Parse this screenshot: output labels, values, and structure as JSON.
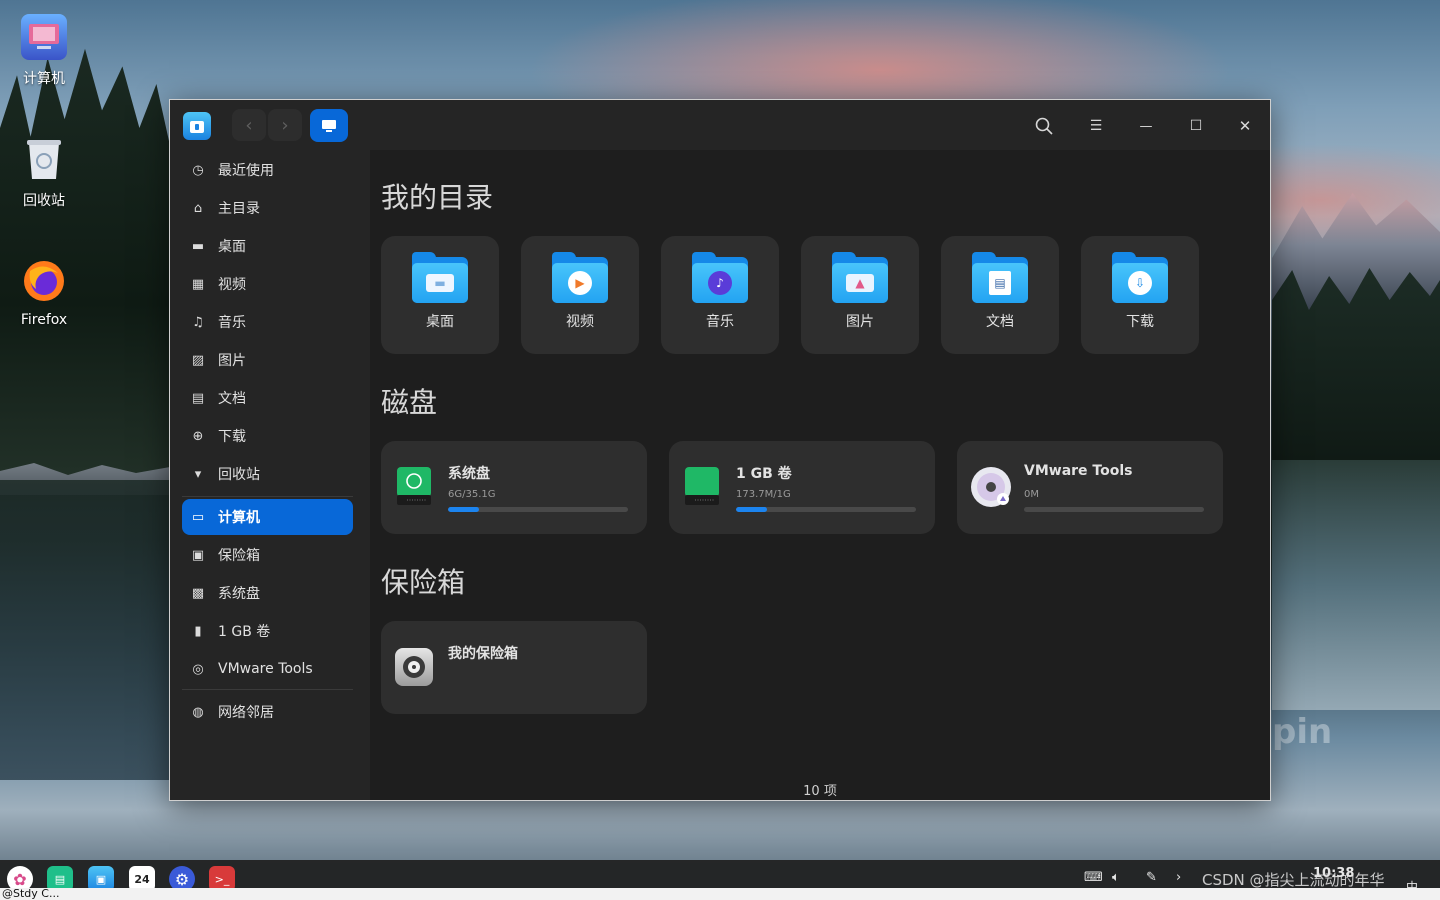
{
  "desktop": {
    "icons": [
      {
        "label": "计算机",
        "icon": "computer-icon"
      },
      {
        "label": "回收站",
        "icon": "trash-icon"
      },
      {
        "label": "Firefox",
        "icon": "firefox-icon"
      }
    ],
    "watermark": "pin"
  },
  "window": {
    "toolbar": {
      "back_icon": "‹",
      "forward_icon": "›",
      "search_icon": "search-icon",
      "menu_icon": "☰",
      "minimize_icon": "—",
      "maximize_icon": "☐",
      "close_icon": "✕"
    },
    "sidebar": {
      "items": [
        {
          "label": "最近使用",
          "icon": "clock-icon",
          "glyph": "◷"
        },
        {
          "label": "主目录",
          "icon": "home-icon",
          "glyph": "⌂"
        },
        {
          "label": "桌面",
          "icon": "desktop-icon",
          "glyph": "▬"
        },
        {
          "label": "视频",
          "icon": "video-icon",
          "glyph": "▦"
        },
        {
          "label": "音乐",
          "icon": "music-icon",
          "glyph": "♫"
        },
        {
          "label": "图片",
          "icon": "picture-icon",
          "glyph": "▨"
        },
        {
          "label": "文档",
          "icon": "document-icon",
          "glyph": "▤"
        },
        {
          "label": "下载",
          "icon": "download-icon",
          "glyph": "⊕"
        },
        {
          "label": "回收站",
          "icon": "trash-icon",
          "glyph": "▾"
        },
        {
          "label": "计算机",
          "icon": "computer-icon",
          "glyph": "▭",
          "active": true
        },
        {
          "label": "保险箱",
          "icon": "vault-icon",
          "glyph": "▣"
        },
        {
          "label": "系统盘",
          "icon": "disk-icon",
          "glyph": "▩"
        },
        {
          "label": "1 GB 卷",
          "icon": "volume-icon",
          "glyph": "▮"
        },
        {
          "label": "VMware Tools",
          "icon": "disc-icon",
          "glyph": "◎"
        },
        {
          "label": "网络邻居",
          "icon": "network-icon",
          "glyph": "◍"
        }
      ]
    },
    "sections": {
      "my_dirs_title": "我的目录",
      "disks_title": "磁盘",
      "vault_title": "保险箱"
    },
    "folders": [
      {
        "label": "桌面",
        "icon": "desktop-folder-icon",
        "glyph": "▬"
      },
      {
        "label": "视频",
        "icon": "video-folder-icon",
        "glyph": "▶"
      },
      {
        "label": "音乐",
        "icon": "music-folder-icon",
        "glyph": "♪"
      },
      {
        "label": "图片",
        "icon": "picture-folder-icon",
        "glyph": "▲"
      },
      {
        "label": "文档",
        "icon": "document-folder-icon",
        "glyph": "▤"
      },
      {
        "label": "下载",
        "icon": "download-folder-icon",
        "glyph": "⇩"
      }
    ],
    "disks": [
      {
        "name": "系统盘",
        "size": "6G/35.1G",
        "used_fraction": 0.17,
        "icon": "system-disk-icon"
      },
      {
        "name": "1 GB 卷",
        "size": "173.7M/1G",
        "used_fraction": 0.17,
        "icon": "volume-disk-icon"
      },
      {
        "name": "VMware Tools",
        "size": "0M",
        "used_fraction": 0.0,
        "icon": "optical-disc-icon"
      }
    ],
    "vault": {
      "name": "我的保险箱",
      "icon": "safe-icon"
    },
    "status": "10 项"
  },
  "taskbar": {
    "apps": [
      {
        "name": "launcher-icon",
        "glyph": "✿"
      },
      {
        "name": "multitask-icon",
        "glyph": "▤"
      },
      {
        "name": "file-manager-icon",
        "glyph": "▣"
      },
      {
        "name": "calendar-icon",
        "glyph": "24"
      },
      {
        "name": "settings-icon",
        "glyph": "⚙"
      },
      {
        "name": "terminal-icon",
        "glyph": ">_"
      }
    ],
    "time": "10:38",
    "ime": "中",
    "watermark_text": "CSDN @指尖上流动的年华",
    "bottom_text": "@Stdy C..."
  },
  "colors": {
    "accent": "#0868d8",
    "folder_blue": "#23a3f2",
    "disk_bar": "#1c84ef",
    "window_bg": "#1e1e1e",
    "sidebar_bg": "#252525",
    "tile_bg": "#2e2e2e"
  }
}
